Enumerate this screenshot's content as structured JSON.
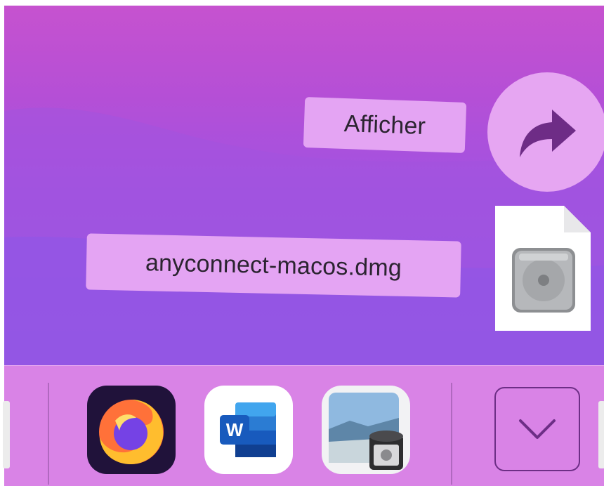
{
  "desktop": {
    "stack_popup": {
      "show_label": "Afficher",
      "file_name": "anyconnect-macos.dmg"
    }
  },
  "dock": {
    "apps": [
      {
        "name": "Firefox",
        "icon": "firefox-icon"
      },
      {
        "name": "Microsoft Word",
        "icon": "word-icon"
      },
      {
        "name": "Preview",
        "icon": "preview-icon"
      }
    ],
    "downloads_stack_icon": "chevron-down-icon"
  },
  "colors": {
    "desktop_top": "#c652cf",
    "desktop_bottom": "#8e58e6",
    "pill": "#e4a4f3",
    "dock": "#d983e6",
    "accent_dark": "#6d2e86"
  }
}
